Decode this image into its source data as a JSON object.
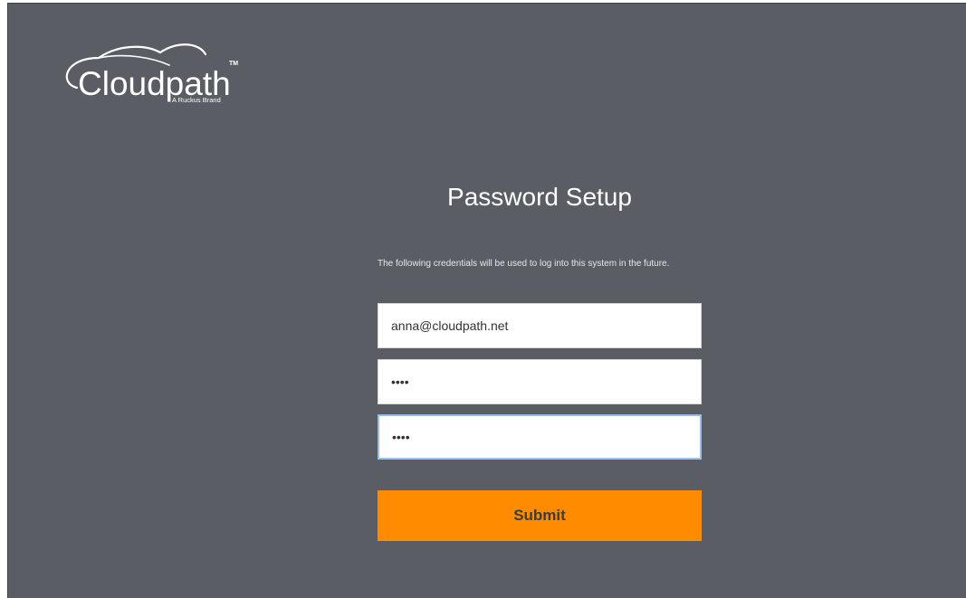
{
  "branding": {
    "name": "Cloudpath",
    "trademark": "TM",
    "tagline": "A Ruckus Brand"
  },
  "form": {
    "title": "Password Setup",
    "description": "The following credentials will be used to log into this system in the future.",
    "email_value": "anna@cloudpath.net",
    "password_value": "abcd",
    "confirm_password_value": "abcd",
    "submit_label": "Submit"
  },
  "colors": {
    "background": "#5a5e64",
    "submit_button": "#ff8c00",
    "focus_border": "#9cbfe8"
  }
}
